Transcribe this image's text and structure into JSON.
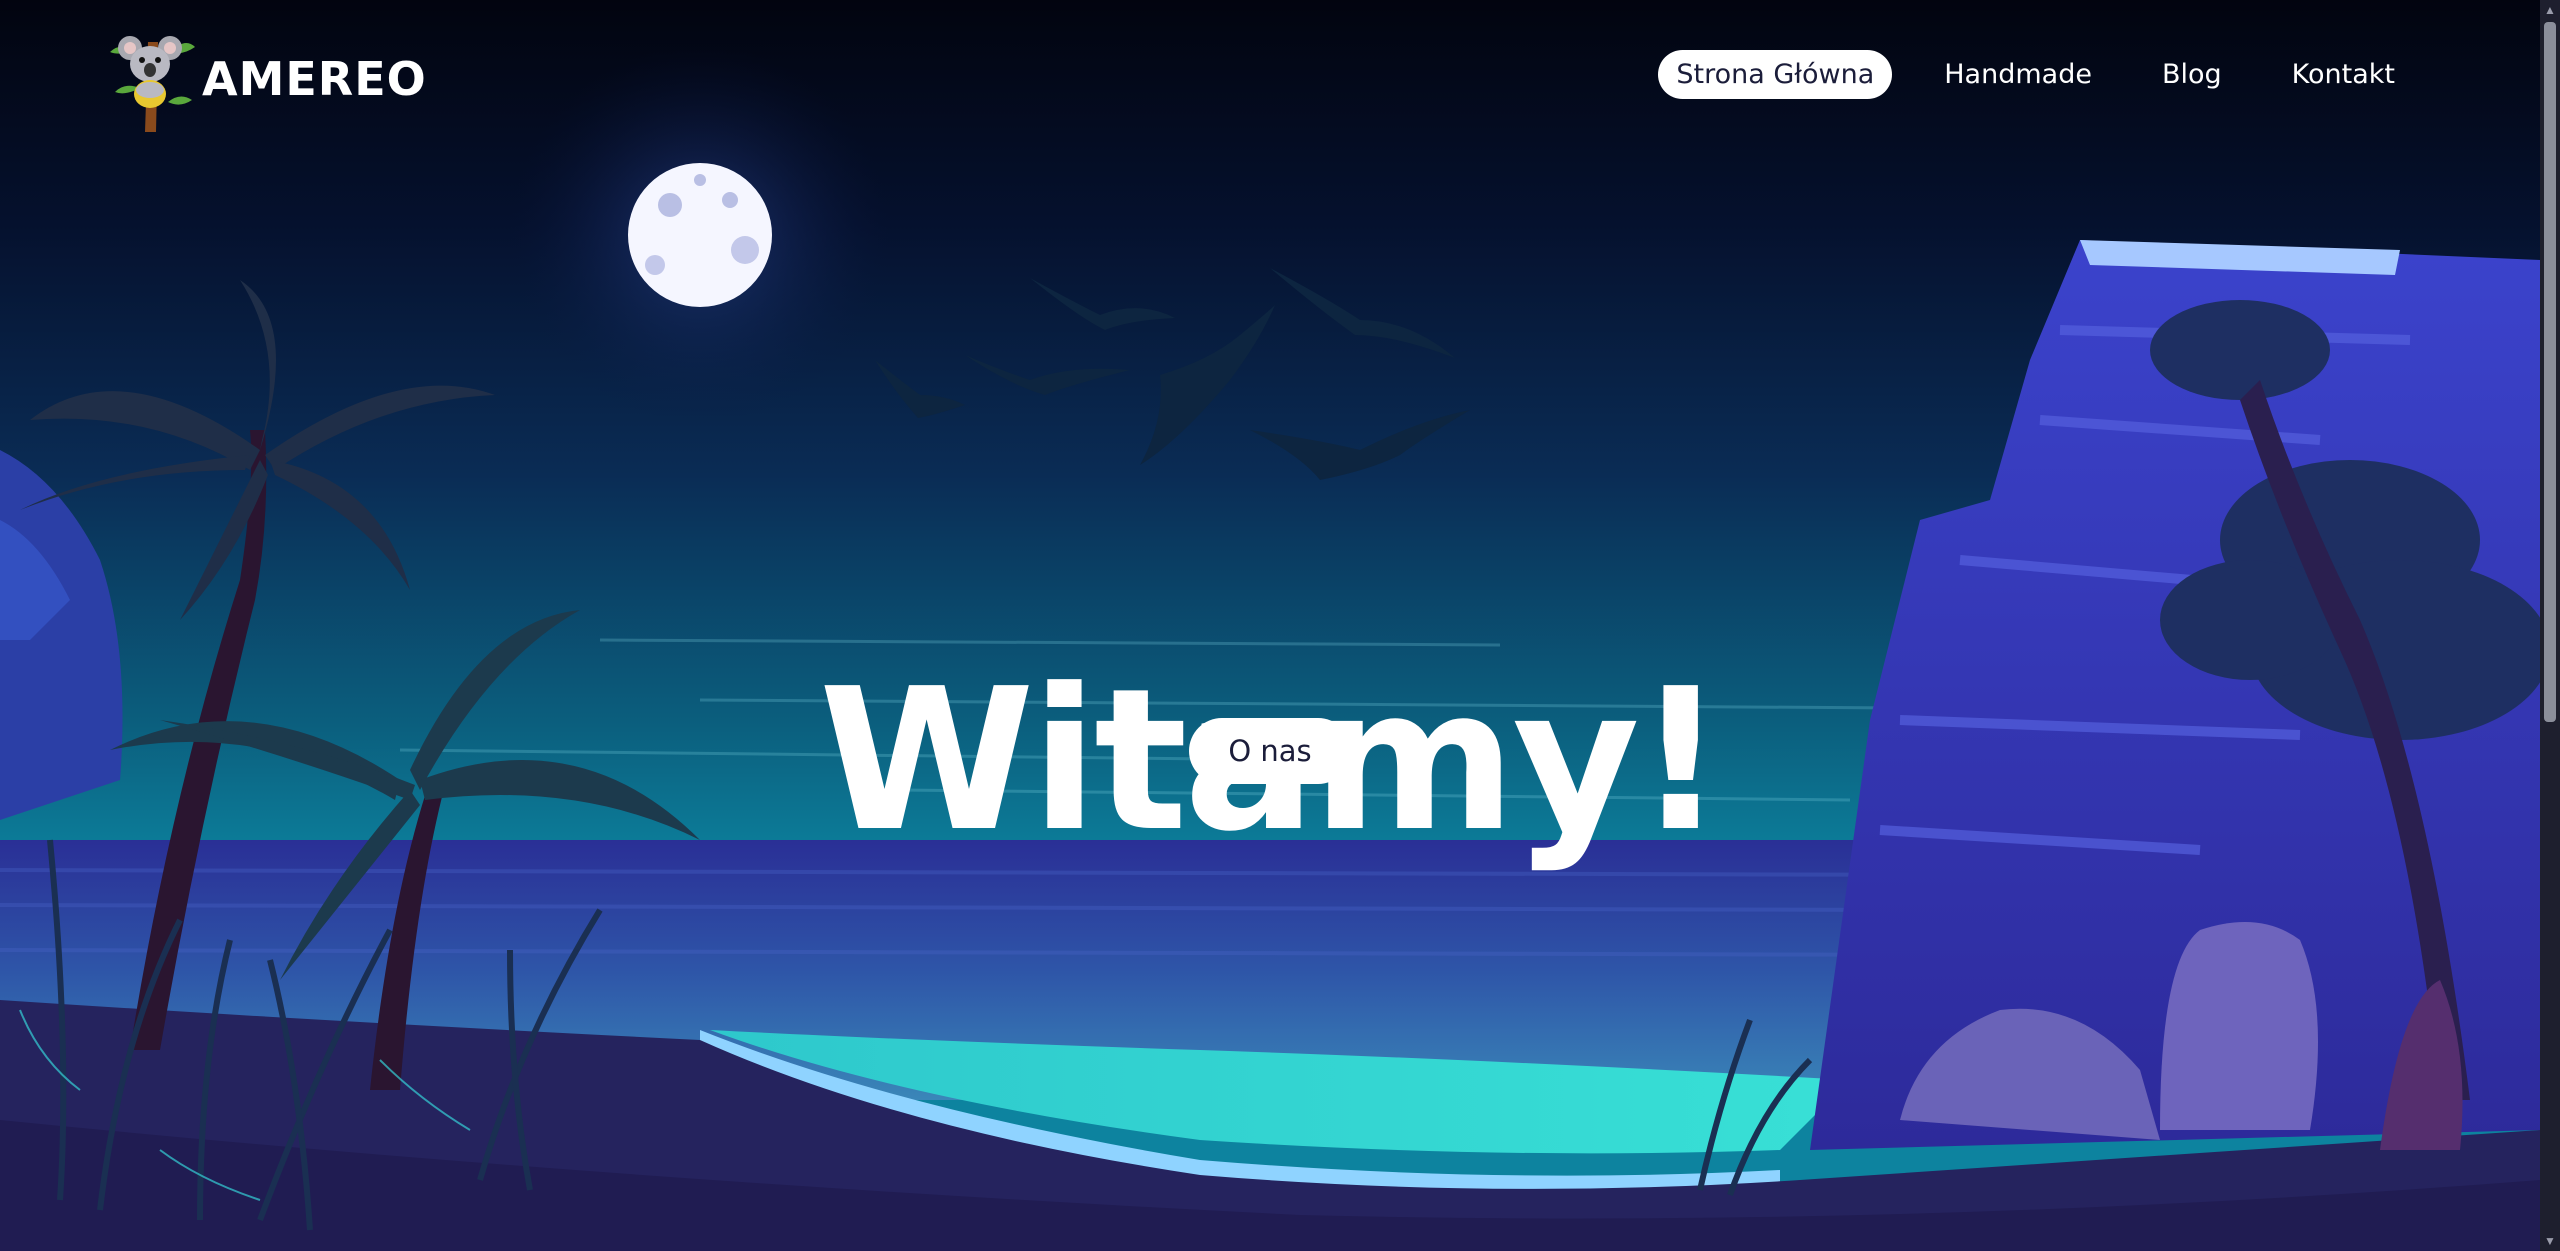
{
  "brand": {
    "name": "AMEREO",
    "logo_icon": "koala-on-branch-icon"
  },
  "nav": {
    "items": [
      {
        "label": "Strona Główna",
        "active": true
      },
      {
        "label": "Handmade",
        "active": false
      },
      {
        "label": "Blog",
        "active": false
      },
      {
        "label": "Kontakt",
        "active": false
      }
    ]
  },
  "hero": {
    "title": "Witamy!",
    "button_label": "O nas"
  },
  "colors": {
    "sky_top": "#030616",
    "sky_mid": "#0a2a52",
    "horizon": "#0d7f9c",
    "sea": "#2b3a8e",
    "lagoon": "#35d6d2",
    "cliff": "#3a3fc4",
    "sand": "#26245e",
    "accent_white": "#ffffff",
    "text_dark": "#1b1d3a"
  }
}
